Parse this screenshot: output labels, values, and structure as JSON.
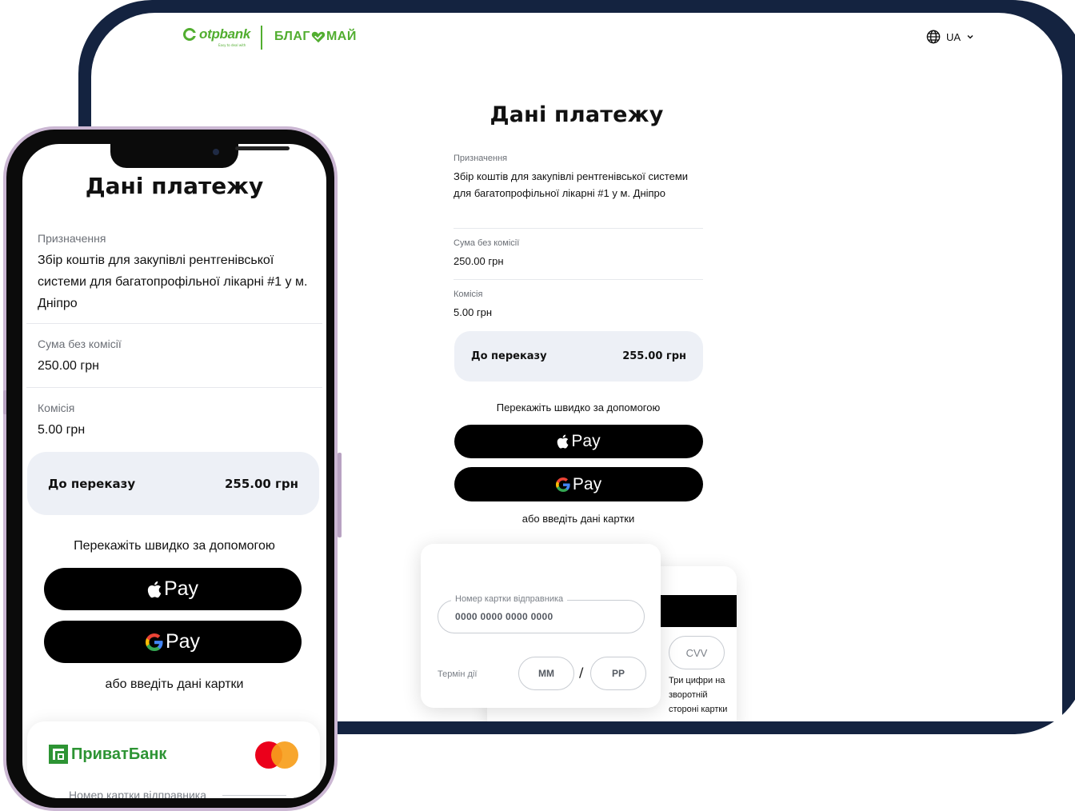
{
  "tablet": {
    "brand": {
      "otp_word": "otpbank",
      "otp_tagline": "Easy to deal with",
      "blagomay_left": "БЛАГ",
      "blagomay_right": "МАЙ"
    },
    "language": {
      "selected": "UA"
    },
    "title": "Дані платежу",
    "purpose": {
      "label": "Призначення",
      "value": "Збір коштів для закупівлі рентгенівської системи для багатопрофільної лікарні #1 у м. Дніпро"
    },
    "amount": {
      "label": "Сума без комісії",
      "value": "250.00 грн"
    },
    "fee": {
      "label": "Комісія",
      "value": "5.00 грн"
    },
    "total": {
      "label": "До переказу",
      "value": "255.00 грн"
    },
    "quick_pay_text": "Перекажіть швидко за допомогою",
    "apple_pay_label": "Pay",
    "google_pay_label": "Pay",
    "or_card_text": "або введіть дані картки",
    "card_front": {
      "card_number_label": "Номер картки відправника",
      "card_number_placeholder": "0000 0000 0000 0000",
      "expiry_label": "Термін дії",
      "month_placeholder": "MM",
      "separator": "/",
      "year_placeholder": "РР"
    },
    "card_back": {
      "cvv_placeholder": "CVV",
      "cvv_hint": "Три цифри на зворотній стороні картки"
    }
  },
  "phone": {
    "title": "Дані платежу",
    "purpose": {
      "label": "Призначення",
      "value": "Збір коштів для закупівлі рентгенівської системи для багатопрофільної лікарні #1 у м. Дніпро"
    },
    "amount": {
      "label": "Сума без комісії",
      "value": "250.00 грн"
    },
    "fee": {
      "label": "Комісія",
      "value": "5.00 грн"
    },
    "total": {
      "label": "До переказу",
      "value": "255.00 грн"
    },
    "quick_pay_text": "Перекажіть швидко за допомогою",
    "apple_pay_label": "Pay",
    "google_pay_label": "Pay",
    "or_card_text": "або введіть дані картки",
    "card": {
      "bank_name": "ПриватБанк",
      "card_number_label": "Номер картки відправника"
    }
  },
  "colors": {
    "brand_green": "#52ae30",
    "tablet_frame": "#142340",
    "phone_frame": "#cbb7d3",
    "summary_bg": "#edf0f6",
    "mastercard_red": "#eb001b",
    "mastercard_orange": "#f79e1b"
  },
  "icons": [
    "otp-logo-icon",
    "heart-icon",
    "globe-icon",
    "chevron-down-icon",
    "apple-icon",
    "google-g-icon",
    "privatbank-logo-icon",
    "mastercard-logo-icon"
  ]
}
